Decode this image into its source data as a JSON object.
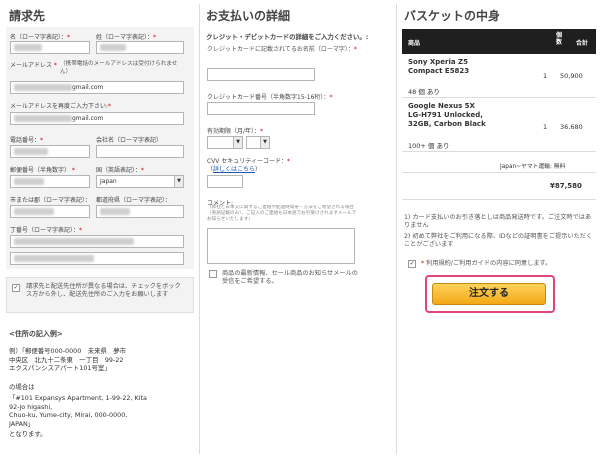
{
  "billing": {
    "title": "請求先",
    "first_name_label": "名（ローマ字表記）：",
    "last_name_label": "姓（ローマ字表記）：",
    "email_label": "メールアドレス",
    "email_note": "（携帯電話のメールアドレスは受付けられません）",
    "email_value_suffix": "gmail.com",
    "email_confirm_label": "メールアドレスを再度ご入力下さい:",
    "email_confirm_value_suffix": "gmail.com",
    "phone_label": "電話番号：",
    "company_label": "会社名（ローマ字表記）",
    "postcode_label": "郵便番号（半角数字）",
    "country_label": "国（英語表記）：",
    "country_value": "Japan",
    "city_label": "市または郡（ローマ字表記）：",
    "prefecture_label": "都道府県（ローマ字表記）：",
    "street_label": "丁番号（ローマ字表記）：",
    "same_address_text": "請求先と配送先住所が異なる場合は、チェックをボックス方から外し、配送先住所のご入力をお願いします",
    "required_mark": "*",
    "address_example_title": "<住所の記入例>",
    "address_example_jp": "例）「郵便番号000-0000　未来県　夢市\n中央区　北九十二条東　一丁目　99-22\nエクスパンシスアパート101号室」",
    "address_example_intro": "の場合は",
    "address_example_en": "「#101 Expansys Apartment, 1-99-22, Kita\n92-jo higashi,\nChuo-ku, Yume-city, Mirai, 000-0000,\nJAPAN」",
    "address_example_outro": "となります。"
  },
  "payment": {
    "title": "お支払いの詳細",
    "subtitle": "クレジット・デビットカードの詳細をご入力ください。:",
    "card_name_label": "クレジットカードに記載されてるお名前（ローマ字）：",
    "card_number_label": "クレジットカード番号（半角数字15-16桁）：",
    "expiry_label": "有効期限（月/年）：",
    "cvv_label": "CVV セキュリティーコード：",
    "cvv_help_prefix": "（",
    "cvv_help_link": "詳しくはこちら",
    "cvv_help_suffix": "）",
    "comment_label": "コメント:",
    "comment_note": "（弊社と日本交に関するご連絡や配送時間帯・方法をご希望される場合（英語記載のみ）、ご記入のご連絡も日本語でお引受けされますメールでお知らせいたします）",
    "newsletter_text": "商品の最新情報、セール商品のお知らせメールの受信をご希望する。",
    "required_mark": "*"
  },
  "basket": {
    "title": "バスケットの中身",
    "col_product": "商品",
    "col_qty": "個数",
    "col_total": "合計",
    "items": [
      {
        "name": "Sony Xperia Z5\nCompact E5823",
        "qty": "1",
        "total": "50,900",
        "stock": "48 個 あり"
      },
      {
        "name": "Google Nexus 5X\nLG-H791 Unlocked,\n32GB, Carbon Black",
        "qty": "1",
        "total": "36,680",
        "stock": "100+ 個 あり"
      }
    ],
    "shipping_label": "Japan~ヤマト運輸: 無料",
    "grand_total": "¥87,580",
    "note1": "1) カード支払いのお引き落としは商品発送時です。ご注文時ではありません",
    "note2": "2) 初めて弊社をご利用になる際、IDなどの証明書をご提示いただくことがございます",
    "terms_text": "利用規約/ご利用ガイドの内容に同意します。",
    "terms_required": "*",
    "order_button": "注文する"
  }
}
